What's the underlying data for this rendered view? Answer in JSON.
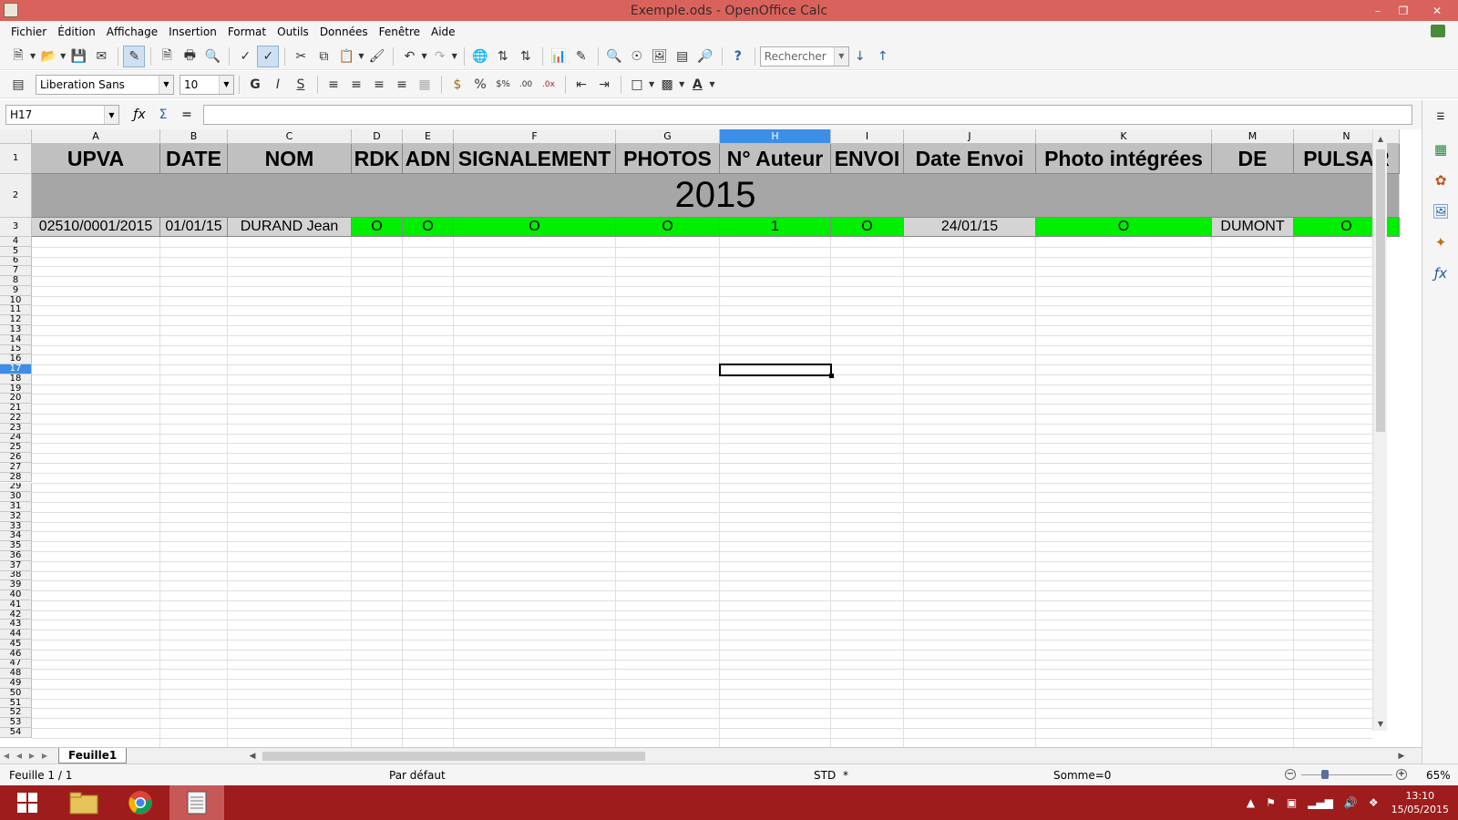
{
  "window": {
    "title": "Exemple.ods - OpenOffice Calc"
  },
  "menu": {
    "items": [
      "Fichier",
      "Édition",
      "Affichage",
      "Insertion",
      "Format",
      "Outils",
      "Données",
      "Fenêtre",
      "Aide"
    ]
  },
  "toolbar": {
    "search_placeholder": "Rechercher"
  },
  "formatbar": {
    "font_name": "Liberation Sans",
    "font_size": "10"
  },
  "formula": {
    "cell_ref": "H17",
    "content": ""
  },
  "sheet": {
    "columns": [
      "A",
      "B",
      "C",
      "D",
      "E",
      "F",
      "G",
      "H",
      "I",
      "J",
      "K",
      "M",
      "N"
    ],
    "selected_column": "H",
    "selected_row": "17",
    "headers": [
      "UPVA",
      "DATE",
      "NOM",
      "RDK",
      "ADN",
      "SIGNALEMENT",
      "PHOTOS",
      "N° Auteur",
      "ENVOI",
      "Date Envoi",
      "Photo intégrées",
      "DE",
      "PULSAR"
    ],
    "year": "2015",
    "row3": [
      "02510/0001/2015",
      "01/01/15",
      "DURAND Jean",
      "O",
      "O",
      "O",
      "O",
      "1",
      "O",
      "24/01/15",
      "O",
      "DUMONT",
      "O"
    ],
    "row3_colors": [
      "#d4d4d4",
      "#d4d4d4",
      "#d4d4d4",
      "#00ee00",
      "#00ee00",
      "#00ee00",
      "#00ee00",
      "#00ee00",
      "#00ee00",
      "#d4d4d4",
      "#00ee00",
      "#d4d4d4",
      "#00ee00"
    ],
    "row_numbers": [
      "1",
      "2",
      "3",
      "4",
      "5",
      "6",
      "7",
      "8",
      "9",
      "10",
      "11",
      "12",
      "13",
      "14",
      "15",
      "16",
      "17",
      "18",
      "19",
      "20",
      "21",
      "22",
      "23",
      "24",
      "25",
      "26",
      "27",
      "28",
      "29",
      "30",
      "31",
      "32",
      "33",
      "34",
      "35",
      "36",
      "37",
      "38",
      "39",
      "40",
      "41",
      "42",
      "43",
      "44",
      "45",
      "46",
      "47",
      "48",
      "49",
      "50",
      "51",
      "52",
      "53",
      "54"
    ]
  },
  "sheet_tabs": {
    "active": "Feuille1"
  },
  "status": {
    "sheet": "Feuille 1 / 1",
    "style": "Par défaut",
    "mode": "STD",
    "modified": "*",
    "sum": "Somme=0",
    "zoom": "65%"
  },
  "taskbar": {
    "time": "13:10",
    "date": "15/05/2015"
  }
}
